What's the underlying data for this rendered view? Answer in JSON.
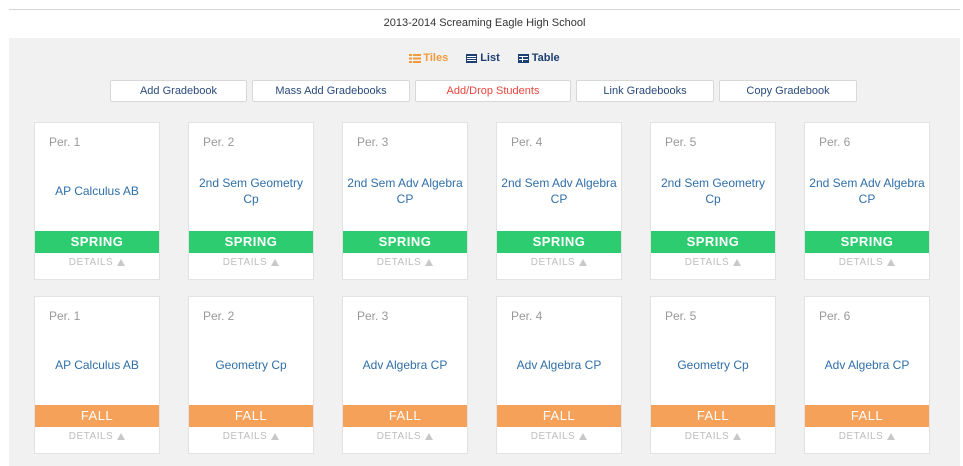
{
  "header": {
    "title": "2013-2014 Screaming Eagle High School"
  },
  "view_toggle": [
    {
      "label": "Tiles",
      "icon": "tiles-icon",
      "active": true
    },
    {
      "label": "List",
      "icon": "list-icon",
      "active": false
    },
    {
      "label": "Table",
      "icon": "table-icon",
      "active": false
    }
  ],
  "actions": [
    {
      "label": "Add Gradebook",
      "name": "add-gradebook-button"
    },
    {
      "label": "Mass Add Gradebooks",
      "name": "mass-add-gradebooks-button"
    },
    {
      "label": "Add/Drop Students",
      "name": "add-drop-students-button",
      "highlight": true
    },
    {
      "label": "Link Gradebooks",
      "name": "link-gradebooks-button"
    },
    {
      "label": "Copy Gradebook",
      "name": "copy-gradebook-button"
    }
  ],
  "gradebooks": {
    "details_label": "DETAILS",
    "rows": [
      [
        {
          "period": "Per. 1",
          "course": "AP Calculus AB",
          "term": "SPRING"
        },
        {
          "period": "Per. 2",
          "course": "2nd Sem Geometry Cp",
          "term": "SPRING"
        },
        {
          "period": "Per. 3",
          "course": "2nd Sem Adv Algebra CP",
          "term": "SPRING"
        },
        {
          "period": "Per. 4",
          "course": "2nd Sem Adv Algebra CP",
          "term": "SPRING"
        },
        {
          "period": "Per. 5",
          "course": "2nd Sem Geometry Cp",
          "term": "SPRING"
        },
        {
          "period": "Per. 6",
          "course": "2nd Sem Adv Algebra CP",
          "term": "SPRING"
        }
      ],
      [
        {
          "period": "Per. 1",
          "course": "AP Calculus AB",
          "term": "FALL"
        },
        {
          "period": "Per. 2",
          "course": "Geometry Cp",
          "term": "FALL"
        },
        {
          "period": "Per. 3",
          "course": "Adv Algebra CP",
          "term": "FALL"
        },
        {
          "period": "Per. 4",
          "course": "Adv Algebra CP",
          "term": "FALL"
        },
        {
          "period": "Per. 5",
          "course": "Geometry Cp",
          "term": "FALL"
        },
        {
          "period": "Per. 6",
          "course": "Adv Algebra CP",
          "term": "FALL"
        }
      ]
    ]
  },
  "colors": {
    "spring": "#2ecc71",
    "fall": "#f5a15a",
    "active_toggle": "#f39b3c",
    "link": "#2f6fa8"
  }
}
